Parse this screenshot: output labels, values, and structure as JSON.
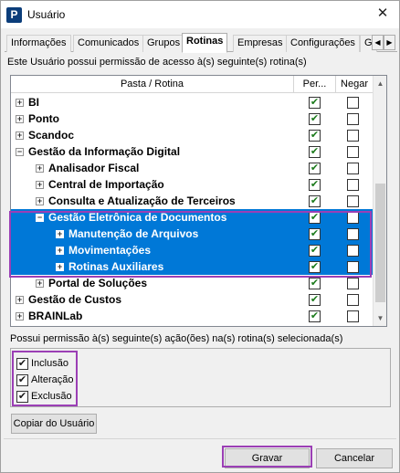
{
  "window": {
    "title": "Usuário",
    "icon": "app-logo-icon",
    "close_glyph": "✕"
  },
  "tabs": [
    {
      "label": "Informações",
      "active": false
    },
    {
      "label": "Comunicados",
      "active": false
    },
    {
      "label": "Grupos",
      "active": false
    },
    {
      "label": "Rotinas",
      "active": true
    },
    {
      "label": "Empresas",
      "active": false
    },
    {
      "label": "Configurações",
      "active": false
    },
    {
      "label": "G",
      "active": false
    }
  ],
  "tab_scroll": {
    "left": "◀",
    "right": "▶"
  },
  "info_text": "Este Usuário possui permissão de acesso à(s) seguinte(s) rotina(s)",
  "grid": {
    "headers": {
      "path": "Pasta / Rotina",
      "permit": "Per...",
      "deny": "Negar"
    },
    "rows": [
      {
        "label": "BI",
        "level": 0,
        "expander": "+",
        "permit": true,
        "deny": false,
        "selected": false
      },
      {
        "label": "Ponto",
        "level": 0,
        "expander": "+",
        "permit": true,
        "deny": false,
        "selected": false
      },
      {
        "label": "Scandoc",
        "level": 0,
        "expander": "+",
        "permit": true,
        "deny": false,
        "selected": false
      },
      {
        "label": "Gestão da Informação Digital",
        "level": 0,
        "expander": "−",
        "permit": true,
        "deny": false,
        "selected": false
      },
      {
        "label": "Analisador Fiscal",
        "level": 1,
        "expander": "+",
        "permit": true,
        "deny": false,
        "selected": false
      },
      {
        "label": "Central de Importação",
        "level": 1,
        "expander": "+",
        "permit": true,
        "deny": false,
        "selected": false
      },
      {
        "label": "Consulta e Atualização de Terceiros",
        "level": 1,
        "expander": "+",
        "permit": true,
        "deny": false,
        "selected": false
      },
      {
        "label": "Gestão Eletrônica de Documentos",
        "level": 1,
        "expander": "−",
        "permit": true,
        "deny": false,
        "selected": true
      },
      {
        "label": "Manutenção de Arquivos",
        "level": 2,
        "expander": "+",
        "permit": true,
        "deny": false,
        "selected": true
      },
      {
        "label": "Movimentações",
        "level": 2,
        "expander": "+",
        "permit": true,
        "deny": false,
        "selected": true
      },
      {
        "label": "Rotinas Auxiliares",
        "level": 2,
        "expander": "+",
        "permit": true,
        "deny": false,
        "selected": true
      },
      {
        "label": "Portal de Soluções",
        "level": 1,
        "expander": "+",
        "permit": true,
        "deny": false,
        "selected": false
      },
      {
        "label": "Gestão de Custos",
        "level": 0,
        "expander": "+",
        "permit": true,
        "deny": false,
        "selected": false
      },
      {
        "label": "BRAINLab",
        "level": 0,
        "expander": "+",
        "permit": true,
        "deny": false,
        "selected": false
      }
    ],
    "scroll_up": "▲",
    "scroll_down": "▼"
  },
  "actions_label": "Possui permissão à(s) seguinte(s) ação(ões) na(s) rotina(s) selecionada(s)",
  "actions": [
    {
      "label": "Inclusão",
      "checked": true
    },
    {
      "label": "Alteração",
      "checked": true
    },
    {
      "label": "Exclusão",
      "checked": true
    }
  ],
  "check_glyph": "✔",
  "buttons": {
    "copy": "Copiar do Usuário",
    "save": "Gravar",
    "cancel": "Cancelar"
  },
  "colors": {
    "selection": "#0078d7",
    "highlight": "#9b3fb5",
    "check": "#1a1a1a"
  }
}
